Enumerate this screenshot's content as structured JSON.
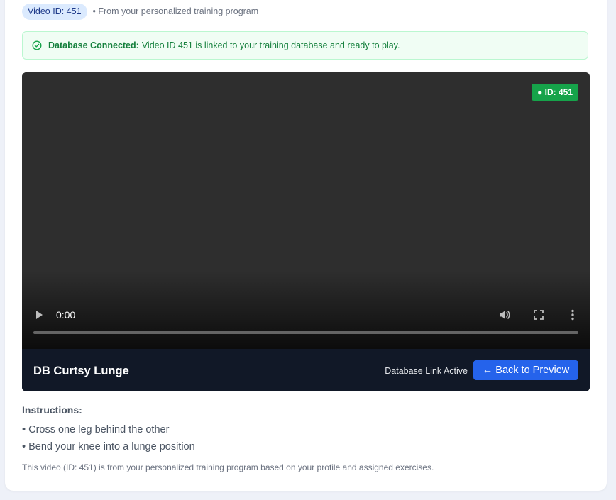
{
  "meta": {
    "video_id_label": "Video ID: 451",
    "source_text": "• From your personalized training program"
  },
  "alert": {
    "title": "Database Connected:",
    "message": "Video ID 451 is linked to your training database and ready to play.",
    "icon": "check-circle-icon",
    "color": "#15803d"
  },
  "player": {
    "id_badge": "● ID: 451",
    "current_time": "0:00",
    "progress": 0,
    "icons": [
      "play-icon",
      "volume-icon",
      "fullscreen-icon",
      "more-options-icon"
    ]
  },
  "info_bar": {
    "title": "DB Curtsy Lunge",
    "link_status": "Database Link Active",
    "back_button": "← Back to Preview"
  },
  "instructions": {
    "heading": "Instructions:",
    "items": [
      "• Cross one leg behind the other",
      "• Bend your knee into a lunge position"
    ]
  },
  "footnote": "This video (ID: 451) is from your personalized training program based on your profile and assigned exercises.",
  "colors": {
    "accent": "#2563eb",
    "success": "#16a34a",
    "dark_bar": "#111827"
  }
}
